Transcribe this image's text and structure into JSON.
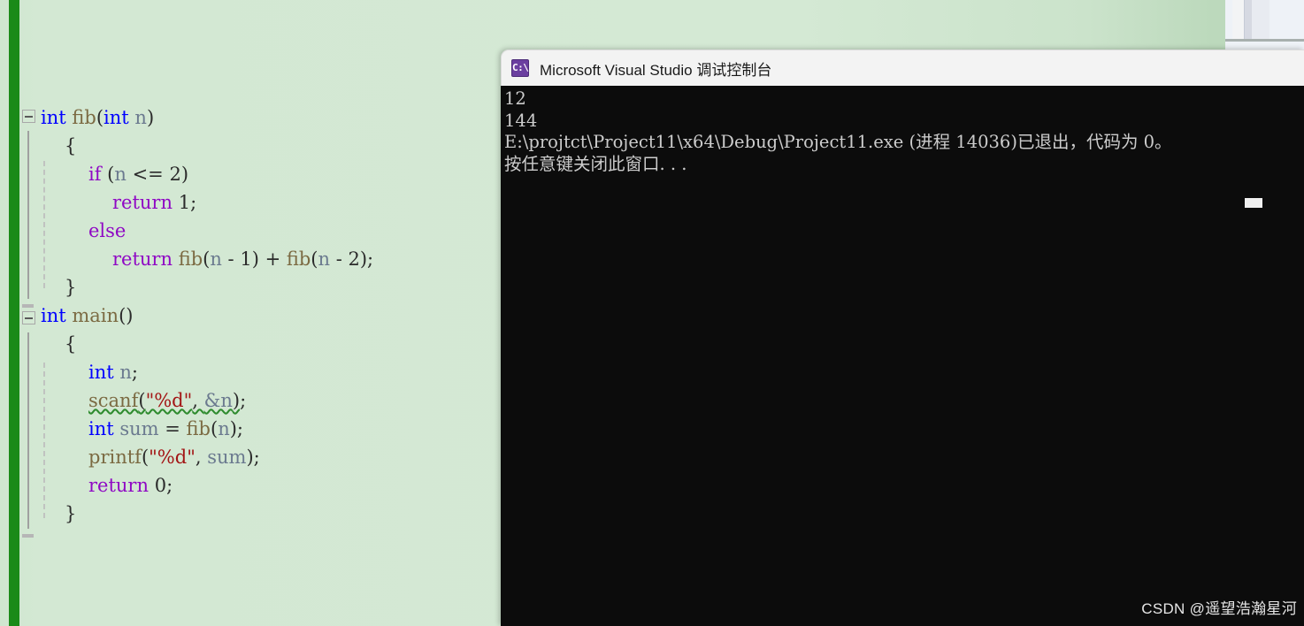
{
  "editor": {
    "name": "visual-studio-code-editor",
    "background_color": "#d4e9d4",
    "change_bar_color": "#1a8a18",
    "lines": [
      {
        "indent": 0,
        "tokens": [
          {
            "text": "int",
            "cls": "kw"
          },
          {
            "text": " ",
            "cls": "punc"
          },
          {
            "text": "fib",
            "cls": "fn"
          },
          {
            "text": "(",
            "cls": "punc"
          },
          {
            "text": "int",
            "cls": "kw"
          },
          {
            "text": " ",
            "cls": "punc"
          },
          {
            "text": "n",
            "cls": "ident"
          },
          {
            "text": ")",
            "cls": "punc"
          }
        ]
      },
      {
        "indent": 1,
        "tokens": [
          {
            "text": "{",
            "cls": "punc"
          }
        ]
      },
      {
        "indent": 2,
        "tokens": [
          {
            "text": "if",
            "cls": "kw2"
          },
          {
            "text": " (",
            "cls": "punc"
          },
          {
            "text": "n",
            "cls": "ident"
          },
          {
            "text": " <= ",
            "cls": "punc"
          },
          {
            "text": "2",
            "cls": "num"
          },
          {
            "text": ")",
            "cls": "punc"
          }
        ]
      },
      {
        "indent": 3,
        "tokens": [
          {
            "text": "return",
            "cls": "kw2"
          },
          {
            "text": " ",
            "cls": "punc"
          },
          {
            "text": "1",
            "cls": "num"
          },
          {
            "text": ";",
            "cls": "punc"
          }
        ]
      },
      {
        "indent": 2,
        "tokens": [
          {
            "text": "else",
            "cls": "kw2"
          }
        ]
      },
      {
        "indent": 3,
        "tokens": [
          {
            "text": "return",
            "cls": "kw2"
          },
          {
            "text": " ",
            "cls": "punc"
          },
          {
            "text": "fib",
            "cls": "fn"
          },
          {
            "text": "(",
            "cls": "punc"
          },
          {
            "text": "n",
            "cls": "ident"
          },
          {
            "text": " - ",
            "cls": "punc"
          },
          {
            "text": "1",
            "cls": "num"
          },
          {
            "text": ") + ",
            "cls": "punc"
          },
          {
            "text": "fib",
            "cls": "fn"
          },
          {
            "text": "(",
            "cls": "punc"
          },
          {
            "text": "n",
            "cls": "ident"
          },
          {
            "text": " - ",
            "cls": "punc"
          },
          {
            "text": "2",
            "cls": "num"
          },
          {
            "text": ");",
            "cls": "punc"
          }
        ]
      },
      {
        "indent": 1,
        "tokens": [
          {
            "text": "}",
            "cls": "punc"
          }
        ]
      },
      {
        "indent": 0,
        "tokens": [
          {
            "text": "int",
            "cls": "kw"
          },
          {
            "text": " ",
            "cls": "punc"
          },
          {
            "text": "main",
            "cls": "fn"
          },
          {
            "text": "()",
            "cls": "punc"
          }
        ]
      },
      {
        "indent": 1,
        "tokens": [
          {
            "text": "{",
            "cls": "punc"
          }
        ]
      },
      {
        "indent": 2,
        "tokens": [
          {
            "text": "int",
            "cls": "kw"
          },
          {
            "text": " ",
            "cls": "punc"
          },
          {
            "text": "n",
            "cls": "ident"
          },
          {
            "text": ";",
            "cls": "punc"
          }
        ]
      },
      {
        "indent": 2,
        "tokens": [
          {
            "text": "scanf",
            "cls": "fn squig"
          },
          {
            "text": "(",
            "cls": "punc squig"
          },
          {
            "text": "\"%d\"",
            "cls": "str squig"
          },
          {
            "text": ", ",
            "cls": "punc squig"
          },
          {
            "text": "&n",
            "cls": "ident squig"
          },
          {
            "text": ")",
            "cls": "punc squig"
          },
          {
            "text": ";",
            "cls": "punc"
          }
        ]
      },
      {
        "indent": 2,
        "tokens": [
          {
            "text": "int",
            "cls": "kw"
          },
          {
            "text": " ",
            "cls": "punc"
          },
          {
            "text": "sum",
            "cls": "ident"
          },
          {
            "text": " = ",
            "cls": "punc"
          },
          {
            "text": "fib",
            "cls": "fn"
          },
          {
            "text": "(",
            "cls": "punc"
          },
          {
            "text": "n",
            "cls": "ident"
          },
          {
            "text": ");",
            "cls": "punc"
          }
        ]
      },
      {
        "indent": 2,
        "tokens": [
          {
            "text": "printf",
            "cls": "fn"
          },
          {
            "text": "(",
            "cls": "punc"
          },
          {
            "text": "\"%d\"",
            "cls": "str"
          },
          {
            "text": ", ",
            "cls": "punc"
          },
          {
            "text": "sum",
            "cls": "ident"
          },
          {
            "text": ");",
            "cls": "punc"
          }
        ]
      },
      {
        "indent": 2,
        "tokens": [
          {
            "text": "return",
            "cls": "kw2"
          },
          {
            "text": " ",
            "cls": "punc"
          },
          {
            "text": "0",
            "cls": "num"
          },
          {
            "text": ";",
            "cls": "punc"
          }
        ]
      },
      {
        "indent": 1,
        "tokens": [
          {
            "text": "}",
            "cls": "punc"
          }
        ]
      }
    ]
  },
  "console": {
    "title": "Microsoft Visual Studio 调试控制台",
    "icon": "console-cmd-icon",
    "icon_glyph": "C:\\",
    "background_color": "#0c0c0c",
    "text_color": "#cccccc",
    "output_lines": [
      "12",
      "144",
      "E:\\projtct\\Project11\\x64\\Debug\\Project11.exe (进程 14036)已退出，代码为 0。",
      "按任意键关闭此窗口. . ."
    ]
  },
  "watermark": {
    "text": "CSDN @遥望浩瀚星河"
  }
}
